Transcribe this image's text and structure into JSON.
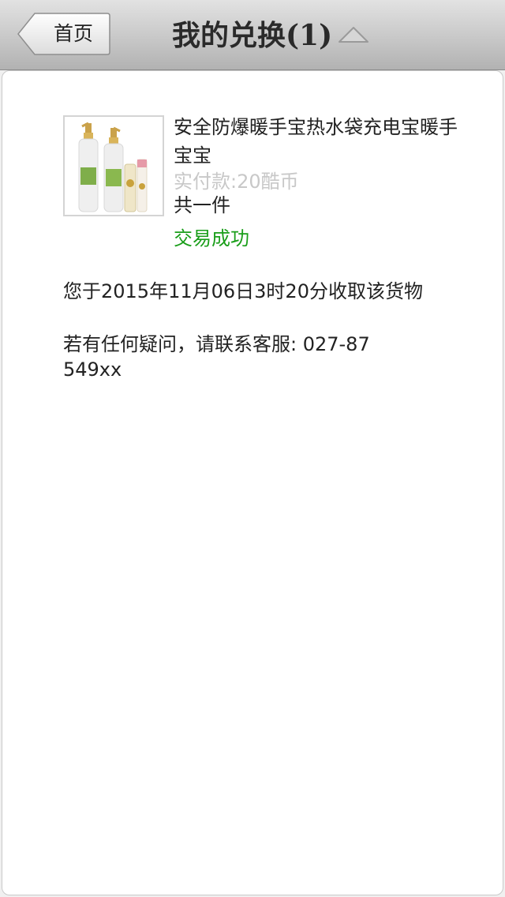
{
  "header": {
    "back_label": "首页",
    "title": "我的兑换(1)"
  },
  "order": {
    "product_name": "安全防爆暖手宝热水袋充电宝暖手宝宝",
    "price": "实付款:20酷币",
    "quantity": "共一件",
    "status": "交易成功",
    "status_color": "#1a9e1a",
    "received_text": "您于2015年11月06日3时20分收取该货物",
    "contact_text": "若有任何疑问，请联系客服: 027-87549xx"
  }
}
